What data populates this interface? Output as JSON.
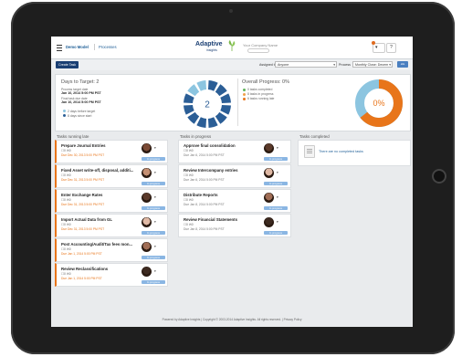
{
  "header": {
    "model": "Demo Model",
    "process": "Processes",
    "logo": "Adaptive",
    "logo_sub": "insights",
    "company": "Your Company Name",
    "help": "?"
  },
  "toolbar": {
    "create": "Create Task",
    "assigned_label": "Assigned to",
    "assigned_value": "Anyone",
    "phase_label": "Process",
    "phase_value": "Monthly Close: Decem"
  },
  "summary": {
    "days_title": "Days to Target: 2",
    "process_target_label": "Process target date",
    "process_target": "Jan 10, 2014 5:00 PM PST",
    "final_due_label": "Final task due date",
    "final_due": "Jan 10, 2014 5:00 PM PST",
    "legend": [
      "2 days before target",
      "8 days since start"
    ],
    "days_center": "2",
    "overall_title": "Overall Progress: 0%",
    "progress_items": [
      "0 tasks completed",
      "8 tasks in progress",
      "6 tasks running late"
    ],
    "overall_center": "0%",
    "colors": {
      "late": "#e8751a",
      "progress": "#f0a04a",
      "done": "#5fb35a",
      "ring": "#2b5e96",
      "ring_light": "#8cc5e0"
    }
  },
  "columns": {
    "late_title": "Tasks running late",
    "progress_title": "Tasks in progress",
    "completed_title": "Tasks completed",
    "late": [
      {
        "title": "Prepare Journal Entries",
        "icons": "☐0  ✉0",
        "due": "Due Dec 30, 2013 5:00 PM PST",
        "status": "In progress"
      },
      {
        "title": "Fixed Asset write-off, disposal, additi...",
        "icons": "☐0  ✉0",
        "due": "Due Dec 31, 2013 5:00 PM PST",
        "status": "In progress"
      },
      {
        "title": "Enter Exchange Rates",
        "icons": "☐0  ✉0",
        "due": "Due Dec 31, 2013 5:00 PM PST",
        "status": "In progress"
      },
      {
        "title": "Import Actual Data from GL",
        "icons": "☐0  ✉0",
        "due": "Due Dec 31, 2013 5:00 PM PST",
        "status": "In progress"
      },
      {
        "title": "Post Accounting/Audit/Tax fees mon...",
        "icons": "☐0  ✉0",
        "due": "Due Jan 1, 2014 5:00 PM PST",
        "status": "In progress"
      },
      {
        "title": "Review Reclassifications",
        "icons": "☐0  ✉0",
        "due": "Due Jan 1, 2014 5:00 PM PST",
        "status": "In progress"
      }
    ],
    "progress": [
      {
        "title": "Approve final consolidation",
        "icons": "☐0  ✉0",
        "due": "Due Jan 6, 2014 5:00 PM PST",
        "status": "In progress"
      },
      {
        "title": "Review Intercompany entries",
        "icons": "☐0  ✉0",
        "due": "Due Jan 6, 2014 5:00 PM PST",
        "status": "In progress"
      },
      {
        "title": "Distribute Reports",
        "icons": "☐0  ✉0",
        "due": "Due Jan 8, 2014 5:00 PM PST",
        "status": "In progress"
      },
      {
        "title": "Review Financial Statements",
        "icons": "☐0  ✉0",
        "due": "Due Jan 8, 2014 5:00 PM PST",
        "status": "In progress"
      }
    ],
    "completed_empty": "There are no completed tasks"
  },
  "footer": "Powered by Adaptive Insights | Copyright © 2003-2014 Adaptive Insights. All rights reserved. | Privacy Policy"
}
